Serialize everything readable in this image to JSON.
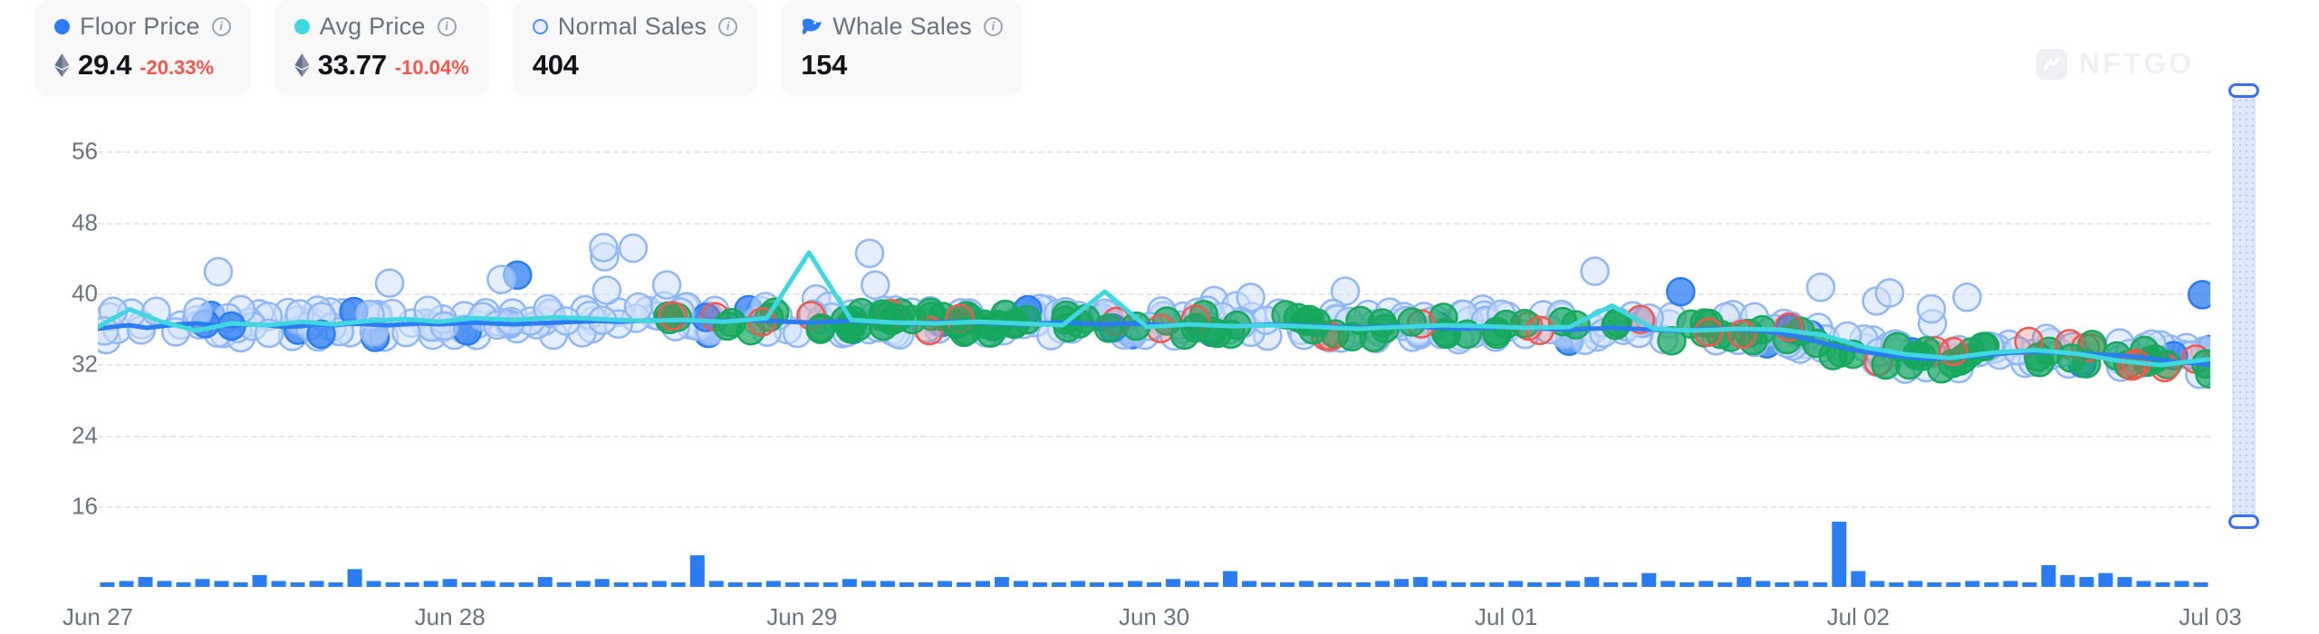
{
  "stats": [
    {
      "label": "Floor Price",
      "marker": "solid-blue-dot",
      "value": "29.4",
      "change": "-20.33%",
      "currency_icon": "ethereum-icon",
      "has_info": true
    },
    {
      "label": "Avg Price",
      "marker": "solid-cyan-dot",
      "value": "33.77",
      "change": "-10.04%",
      "currency_icon": "ethereum-icon",
      "has_info": true
    },
    {
      "label": "Normal Sales",
      "marker": "hollow-blue-dot",
      "value": "404",
      "change": "",
      "currency_icon": "",
      "has_info": true
    },
    {
      "label": "Whale Sales",
      "marker": "whale-icon",
      "value": "154",
      "change": "",
      "currency_icon": "",
      "has_info": true
    }
  ],
  "watermark": {
    "text": "NFTGO"
  },
  "brush": {
    "name": "vertical-range-slider",
    "top_handle": "top-handle",
    "bottom_handle": "bottom-handle"
  },
  "colors": {
    "floor_price": "#2b7cf0",
    "avg_price": "#3fd7e0",
    "normal_sales": "#cfe0fb",
    "normal_sales_stroke": "#8fb6f5",
    "whale_sales_green": "#16a85c",
    "whale_sales_red": "#f5574e",
    "volume_bar": "#2b7cf0",
    "negative": "#f5574e",
    "grid": "#e6e7ea",
    "axis_text": "#6b7280",
    "card_bg": "#f8f8f9"
  },
  "chart_data": {
    "type": "scatter",
    "title": "",
    "xlabel": "",
    "ylabel": "",
    "ylim": [
      12,
      60
    ],
    "yticks": [
      56,
      48,
      40,
      32,
      24,
      16
    ],
    "xticks": [
      "Jun 27",
      "Jun 28",
      "Jun 29",
      "Jun 30",
      "Jul 01",
      "Jul 02",
      "Jul 03"
    ],
    "grid": true,
    "legend_position": "top-left",
    "series": [
      {
        "name": "Floor Price",
        "type": "line",
        "color": "#2b7cf0",
        "x": [
          0,
          0.04,
          0.09,
          0.14,
          0.18,
          0.23,
          0.28,
          0.33,
          0.38,
          0.43,
          0.48,
          0.53,
          0.58,
          0.62,
          0.67,
          0.72,
          0.77,
          0.82,
          0.87,
          0.92,
          0.97,
          1.02,
          1.07,
          1.12,
          1.18,
          1.24,
          1.3,
          1.36,
          1.42,
          1.48,
          1.54,
          1.6,
          1.66,
          1.72,
          1.78,
          1.84,
          1.9,
          1.96,
          2.02,
          2.08,
          2.14,
          2.2,
          2.26,
          2.32,
          2.38,
          2.44,
          2.5,
          2.56,
          2.62,
          2.68,
          2.74,
          2.8,
          2.86,
          2.92,
          2.98,
          3.04,
          3.1,
          3.16,
          3.22,
          3.28,
          3.34,
          3.4,
          3.46,
          3.52,
          3.58,
          3.64,
          3.7,
          3.76,
          3.82,
          3.88,
          3.94,
          4,
          4.06,
          4.12,
          4.18,
          4.24,
          4.3,
          4.36,
          4.42,
          4.48,
          4.54,
          4.6,
          4.66,
          4.72,
          4.78,
          4.84,
          4.9,
          4.96,
          5.02,
          5.08,
          5.14,
          5.2,
          5.26,
          5.32,
          5.38,
          5.44,
          5.5,
          5.56,
          5.62,
          5.68,
          5.74,
          5.8,
          5.86,
          5.92,
          5.98,
          6.04,
          6.1,
          6.16,
          6.22,
          6.28,
          6.34,
          6.4,
          6.46,
          6.52,
          6.58,
          6.64,
          6.7,
          6.76,
          6.82,
          6.88,
          6.94,
          7
        ],
        "y": [
          36.0,
          36.2,
          36.4,
          36.1,
          36.3,
          36.5,
          36.6,
          36.4,
          36.3,
          36.5,
          36.4,
          36.2,
          36.3,
          36.5,
          36.4,
          36.6,
          36.5,
          36.4,
          36.5,
          36.6,
          36.5,
          36.6,
          36.7,
          36.6,
          36.5,
          36.6,
          36.7,
          36.8,
          36.9,
          36.8,
          36.9,
          37.0,
          36.9,
          36.8,
          36.9,
          37.0,
          36.9,
          36.8,
          36.7,
          36.8,
          36.9,
          36.8,
          36.7,
          36.6,
          36.7,
          36.8,
          36.7,
          36.6,
          36.5,
          36.6,
          36.7,
          36.6,
          36.5,
          36.6,
          36.5,
          36.4,
          36.5,
          36.4,
          36.3,
          36.4,
          36.5,
          36.4,
          36.3,
          36.2,
          36.1,
          36.2,
          36.3,
          36.2,
          36.1,
          36.0,
          36.1,
          36.2,
          36.1,
          36.0,
          35.9,
          36.0,
          36.1,
          36.0,
          35.9,
          35.8,
          35.9,
          36.0,
          35.9,
          35.8,
          35.5,
          35.0,
          34.4,
          33.8,
          33.4,
          33.0,
          32.8,
          32.6,
          32.7,
          32.9,
          33.1,
          33.3,
          33.4,
          33.3,
          33.2,
          33.1,
          33.0,
          32.8,
          32.5,
          32.2,
          32.0,
          31.8,
          32.0,
          32.3,
          32.6,
          32.8,
          32.6,
          32.3,
          31.8,
          31.2,
          30.6,
          30.0,
          29.6,
          29.4,
          29.8,
          30.2,
          30.6,
          30.4
        ]
      },
      {
        "name": "Avg Price",
        "type": "line",
        "color": "#3fd7e0",
        "x": [
          0,
          0.09,
          0.18,
          0.28,
          0.38,
          0.48,
          0.58,
          0.67,
          0.77,
          0.87,
          0.97,
          1.07,
          1.18,
          1.3,
          1.42,
          1.54,
          1.66,
          1.78,
          1.9,
          2.02,
          2.14,
          2.26,
          2.38,
          2.5,
          2.62,
          2.74,
          2.86,
          2.98,
          3.1,
          3.22,
          3.34,
          3.46,
          3.58,
          3.7,
          3.82,
          3.94,
          4.06,
          4.18,
          4.3,
          4.42,
          4.54,
          4.66,
          4.78,
          4.9,
          5.02,
          5.14,
          5.26,
          5.38,
          5.5,
          5.62,
          5.74,
          5.86,
          5.98,
          6.1,
          6.22,
          6.34,
          6.46,
          6.58,
          6.7,
          6.82,
          6.94,
          7
        ],
        "y": [
          36.2,
          38.2,
          36.8,
          35.8,
          36.6,
          36.4,
          36.8,
          36.5,
          36.9,
          37.1,
          36.8,
          37.2,
          37.0,
          37.3,
          37.1,
          36.9,
          37.0,
          36.8,
          37.2,
          44.6,
          37.0,
          36.7,
          36.6,
          36.8,
          36.6,
          36.4,
          40.2,
          36.2,
          36.5,
          36.3,
          36.4,
          36.2,
          36.0,
          36.2,
          36.4,
          36.3,
          36.1,
          36.2,
          38.6,
          36.0,
          35.8,
          36.0,
          35.9,
          35.3,
          33.9,
          33.1,
          32.7,
          33.3,
          33.6,
          33.2,
          32.4,
          31.9,
          32.5,
          33.0,
          32.4,
          31.2,
          29.8,
          29.3,
          30.3,
          30.8,
          30.2,
          30.5
        ]
      },
      {
        "name": "Normal Sales",
        "type": "scatter",
        "marker": "hollow-circle",
        "color": "#cfe0fb",
        "count": 404
      },
      {
        "name": "Whale Sales",
        "type": "scatter",
        "marker": "filled-circle",
        "color": "#16a85c",
        "count": 154
      },
      {
        "name": "Volume",
        "type": "bar",
        "color": "#2b7cf0",
        "values": [
          2,
          3,
          5,
          3,
          2,
          4,
          3,
          2,
          6,
          3,
          2,
          3,
          2,
          9,
          3,
          2,
          2,
          3,
          4,
          2,
          3,
          2,
          2,
          5,
          2,
          3,
          4,
          2,
          2,
          3,
          2,
          16,
          3,
          2,
          2,
          3,
          2,
          2,
          2,
          4,
          3,
          3,
          2,
          2,
          3,
          2,
          3,
          5,
          3,
          2,
          2,
          3,
          2,
          2,
          3,
          2,
          4,
          3,
          2,
          8,
          3,
          2,
          2,
          3,
          2,
          2,
          2,
          3,
          4,
          5,
          3,
          2,
          2,
          2,
          3,
          2,
          2,
          3,
          5,
          2,
          2,
          7,
          3,
          2,
          3,
          2,
          5,
          3,
          2,
          3,
          2,
          33,
          8,
          3,
          2,
          3,
          2,
          2,
          3,
          2,
          3,
          2,
          11,
          6,
          5,
          7,
          5,
          3,
          2,
          3,
          2
        ]
      }
    ]
  }
}
